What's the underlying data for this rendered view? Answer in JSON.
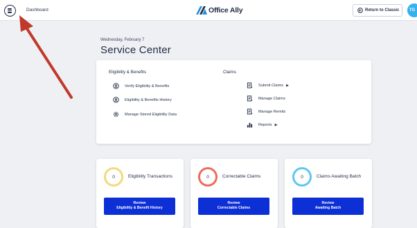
{
  "header": {
    "breadcrumb": "Dashboard",
    "logo_text": "Office Ally",
    "return_label": "Return to Classic",
    "avatar_initials": "TG"
  },
  "page": {
    "date": "Wednesday, February 7",
    "title": "Service Center"
  },
  "services": {
    "eligibility": {
      "heading": "Eligibility & Benefits",
      "items": [
        {
          "label": "Verify Eligibility & Benefits",
          "icon": "search-person-icon"
        },
        {
          "label": "Eligibility & Benefits History",
          "icon": "search-person-icon"
        },
        {
          "label": "Manage Stored Eligibility Data",
          "icon": "gear-icon"
        }
      ]
    },
    "claims": {
      "heading": "Claims",
      "items": [
        {
          "label": "Submit Claims",
          "icon": "document-icon",
          "has_arrow": true
        },
        {
          "label": "Manage Claims",
          "icon": "document-icon"
        },
        {
          "label": "Manage Remits",
          "icon": "document-icon"
        },
        {
          "label": "Reports",
          "icon": "bar-chart-icon",
          "has_arrow": true
        }
      ]
    }
  },
  "stats": [
    {
      "count": "0",
      "label": "Eligibility Transactions",
      "ring_color": "#f4d97a",
      "btn_line1": "Review",
      "btn_line2": "Eligibility & Benefit History"
    },
    {
      "count": "0",
      "label": "Correctable Claims",
      "ring_color": "#ef6a5a",
      "btn_line1": "Review",
      "btn_line2": "Correctable Claims"
    },
    {
      "count": "0",
      "label": "Claims Awaiting Batch",
      "ring_color": "#5cc8ec",
      "btn_line1": "Review",
      "btn_line2": "Awaiting Batch"
    }
  ],
  "colors": {
    "primary": "#0c2fd6",
    "brand_blue": "#1f8ee0",
    "annotation_arrow": "#c0392b"
  }
}
